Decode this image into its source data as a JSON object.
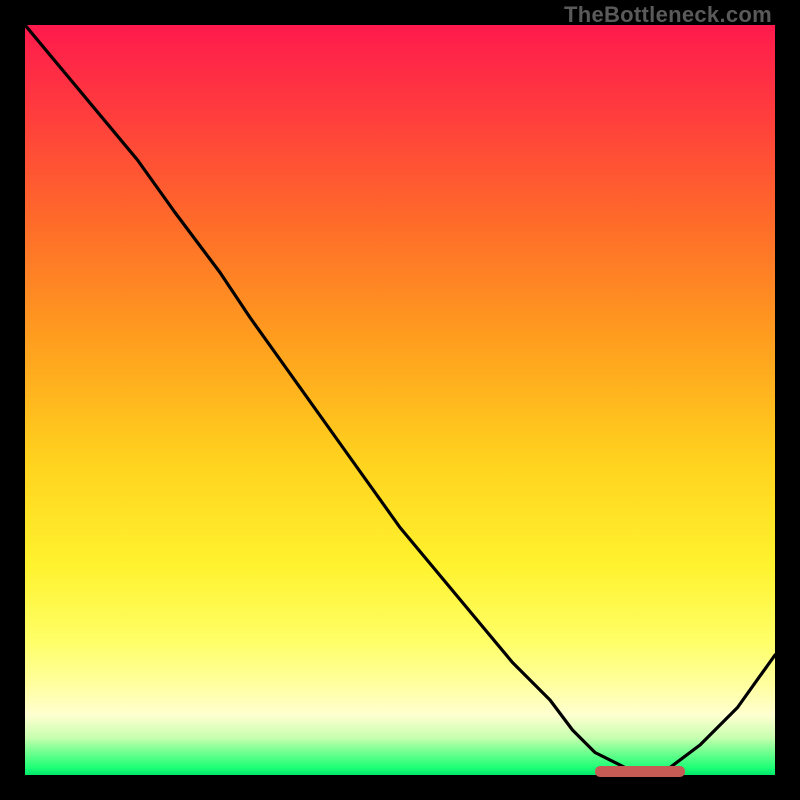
{
  "watermark": "TheBottleneck.com",
  "colors": {
    "curve": "#000000",
    "marker": "#c65a54",
    "gradient_top": "#ff1a4d",
    "gradient_bottom": "#00e86a"
  },
  "chart_data": {
    "type": "line",
    "title": "",
    "xlabel": "",
    "ylabel": "",
    "xlim": [
      0,
      100
    ],
    "ylim": [
      0,
      100
    ],
    "x": [
      0,
      5,
      10,
      15,
      20,
      23,
      26,
      30,
      35,
      40,
      45,
      50,
      55,
      60,
      65,
      70,
      73,
      76,
      80,
      83,
      86,
      90,
      95,
      100
    ],
    "values": [
      100,
      94,
      88,
      82,
      75,
      71,
      67,
      61,
      54,
      47,
      40,
      33,
      27,
      21,
      15,
      10,
      6,
      3,
      1,
      0,
      1,
      4,
      9,
      16
    ],
    "optimal_marker": {
      "x_start": 76,
      "x_end": 88,
      "y": 0
    },
    "annotations": []
  }
}
